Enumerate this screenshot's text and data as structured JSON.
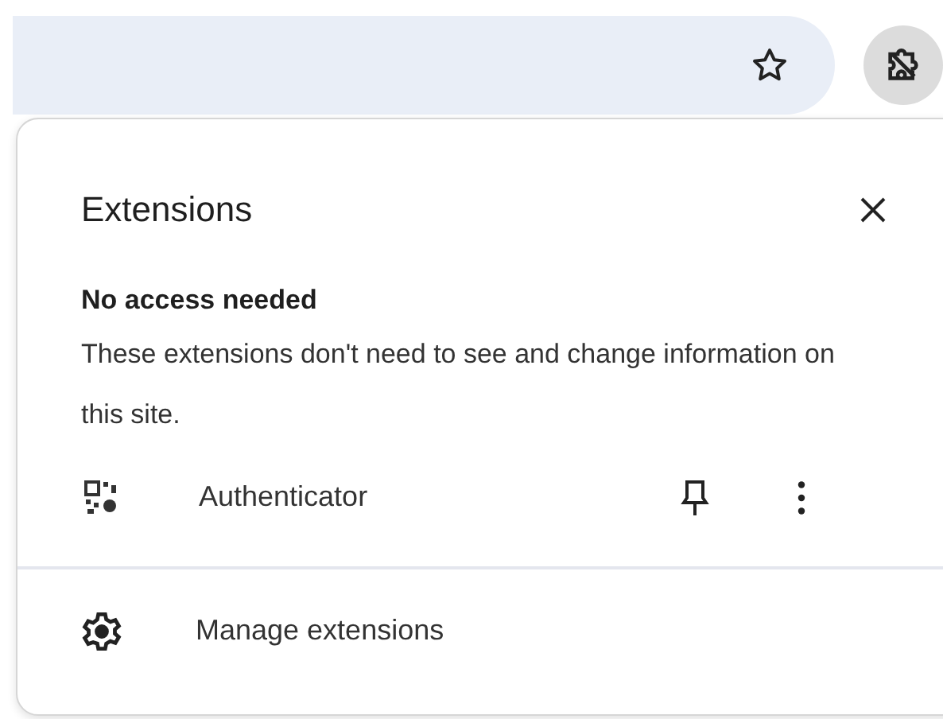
{
  "panel": {
    "title": "Extensions",
    "section": {
      "heading": "No access needed",
      "description": "These extensions don't need to see and change information on this site.",
      "extensions": [
        {
          "name": "Authenticator",
          "pinned": false
        }
      ]
    },
    "footer": {
      "label": "Manage extensions"
    }
  }
}
